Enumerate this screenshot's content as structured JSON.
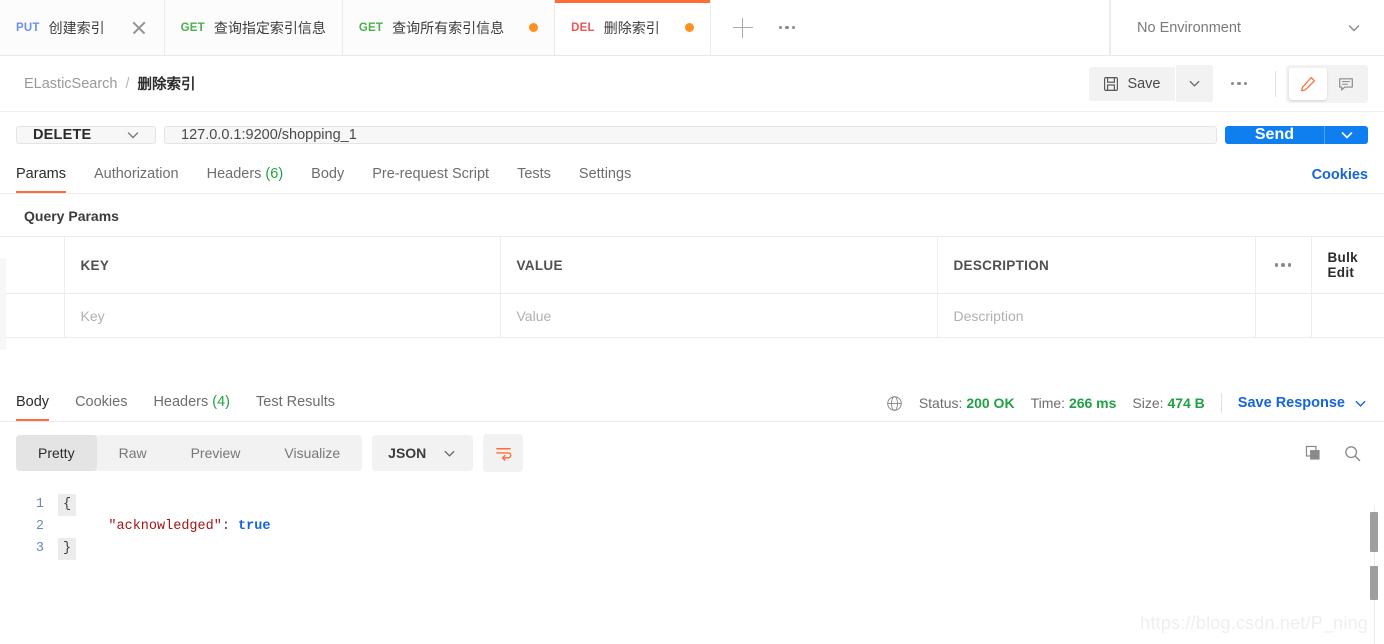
{
  "tabs": [
    {
      "method": "PUT",
      "method_class": "m-put",
      "label": "创建索引",
      "state": "close",
      "active": false
    },
    {
      "method": "GET",
      "method_class": "m-get",
      "label": "查询指定索引信息",
      "state": "none",
      "active": false
    },
    {
      "method": "GET",
      "method_class": "m-get",
      "label": "查询所有索引信息",
      "state": "dot",
      "active": false
    },
    {
      "method": "DEL",
      "method_class": "m-del",
      "label": "删除索引",
      "state": "dot",
      "active": true
    }
  ],
  "tab_actions": {
    "new_tab": "+",
    "more": "•••"
  },
  "environment": {
    "label": "No Environment",
    "caret": "chevron-down"
  },
  "breadcrumb": {
    "collection": "ELasticSearch",
    "separator": "/",
    "request": "删除索引"
  },
  "header_actions": {
    "save_label": "Save",
    "save_icon": "floppy-disk-icon",
    "save_caret": "chevron-down-icon",
    "more": "•••",
    "edit_icon": "pencil-icon",
    "comment_icon": "comment-icon"
  },
  "request": {
    "method": "DELETE",
    "url": "127.0.0.1:9200/shopping_1",
    "send_label": "Send"
  },
  "request_tabs": [
    {
      "label": "Params",
      "count": "",
      "active": true
    },
    {
      "label": "Authorization",
      "count": "",
      "active": false
    },
    {
      "label": "Headers",
      "count": "(6)",
      "active": false
    },
    {
      "label": "Body",
      "count": "",
      "active": false
    },
    {
      "label": "Pre-request Script",
      "count": "",
      "active": false
    },
    {
      "label": "Tests",
      "count": "",
      "active": false
    },
    {
      "label": "Settings",
      "count": "",
      "active": false
    }
  ],
  "cookies_link": "Cookies",
  "query_params": {
    "title": "Query Params",
    "columns": [
      "KEY",
      "VALUE",
      "DESCRIPTION"
    ],
    "bulk_edit": "Bulk Edit",
    "row_more": "•••",
    "rows": [
      {
        "key_placeholder": "Key",
        "value_placeholder": "Value",
        "description_placeholder": "Description"
      }
    ]
  },
  "response": {
    "tabs": [
      {
        "label": "Body",
        "count": "",
        "active": true
      },
      {
        "label": "Cookies",
        "count": "",
        "active": false
      },
      {
        "label": "Headers",
        "count": "(4)",
        "active": false
      },
      {
        "label": "Test Results",
        "count": "",
        "active": false
      }
    ],
    "globe_icon": "globe-icon",
    "status_label": "Status:",
    "status_value": "200 OK",
    "time_label": "Time:",
    "time_value": "266 ms",
    "size_label": "Size:",
    "size_value": "474 B",
    "save_response": "Save Response",
    "format_tabs": [
      {
        "label": "Pretty",
        "active": true
      },
      {
        "label": "Raw",
        "active": false
      },
      {
        "label": "Preview",
        "active": false
      },
      {
        "label": "Visualize",
        "active": false
      }
    ],
    "language": "JSON",
    "wrap_icon": "word-wrap-icon",
    "copy_icon": "copy-icon",
    "search_icon": "search-icon",
    "body": {
      "lines": [
        {
          "no": "1",
          "fold": "{",
          "segments": []
        },
        {
          "no": "2",
          "fold": "",
          "segments": [
            {
              "text": "    \"acknowledged\"",
              "cls": "k-str"
            },
            {
              "text": ": ",
              "cls": "k-punc"
            },
            {
              "text": "true",
              "cls": "k-bool"
            }
          ]
        },
        {
          "no": "3",
          "fold": "}",
          "segments": []
        }
      ]
    }
  },
  "watermark": "https://blog.csdn.net/P_ning",
  "colors": {
    "accent": "#ff6c37",
    "send_blue": "#0f7ff0",
    "link_blue": "#1565d8",
    "success_green": "#20a144",
    "dot_orange": "#ff8f1f",
    "delete_red": "#eb5757",
    "get_green": "#4caf50",
    "put_blue": "#6c8eef"
  }
}
